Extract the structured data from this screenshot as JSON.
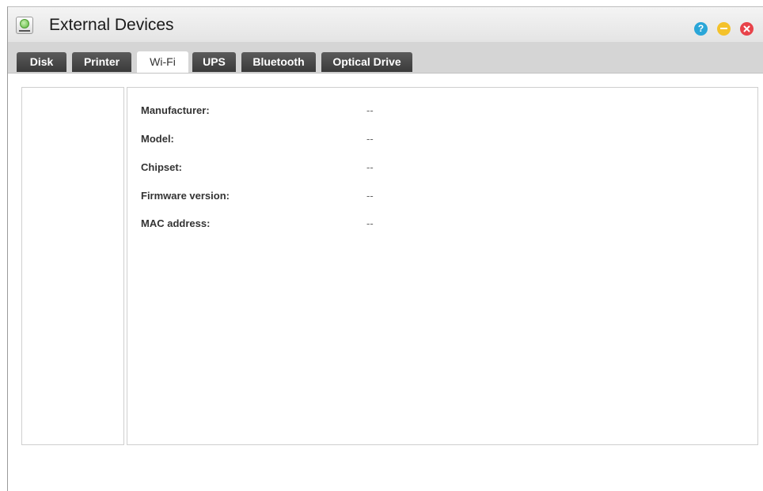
{
  "window": {
    "title": "External Devices"
  },
  "controls": {
    "help_glyph": "?",
    "icons": [
      "help-icon",
      "minimize-icon",
      "close-icon"
    ]
  },
  "tabs": [
    {
      "label": "Disk",
      "active": false
    },
    {
      "label": "Printer",
      "active": false
    },
    {
      "label": "Wi-Fi",
      "active": true
    },
    {
      "label": "UPS",
      "active": false
    },
    {
      "label": "Bluetooth",
      "active": false
    },
    {
      "label": "Optical Drive",
      "active": false
    }
  ],
  "details": [
    {
      "label": "Manufacturer:",
      "value": "--"
    },
    {
      "label": "Model:",
      "value": "--"
    },
    {
      "label": "Chipset:",
      "value": "--"
    },
    {
      "label": "Firmware version:",
      "value": "--"
    },
    {
      "label": "MAC address:",
      "value": "--"
    }
  ],
  "colors": {
    "tab_bg": "#474747",
    "help": "#2aa6d8",
    "minimize": "#f4c22b",
    "close": "#e8434a"
  }
}
